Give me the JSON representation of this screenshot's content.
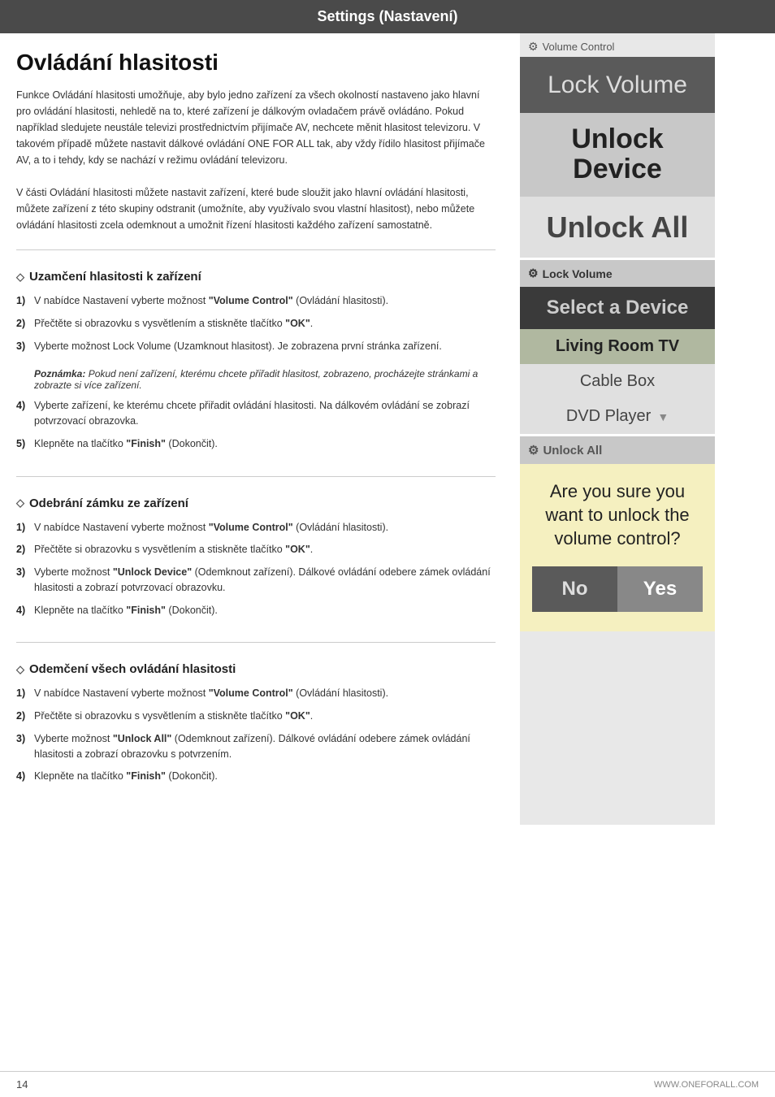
{
  "header": {
    "title": "Settings (Nastavení)"
  },
  "main": {
    "title": "Ovládání hlasitosti",
    "intro": [
      "Funkce Ovládání hlasitosti umožňuje, aby bylo jedno zařízení za všech okolností nastaveno jako hlavní pro ovládání hlasitosti, nehledě na to, které zařízení je dálkovým ovladačem právě ovládáno.  Pokud například sledujete neustále televizi prostřednictvím přijímače AV, nechcete měnit hlasitost televizoru. V takovém případě můžete nastavit dálkové ovládání ONE FOR ALL tak, aby vždy řídilo hlasitost přijímače AV, a to i tehdy, kdy se nachází v režimu ovládání televizoru.",
      "V části Ovládání hlasitosti můžete nastavit zařízení, které bude sloužit jako hlavní ovládání hlasitosti, můžete zařízení z této skupiny odstranit (umožníte, aby využívalo svou vlastní hlasitost), nebo můžete ovládání hlasitosti zcela odemknout a umožnit řízení hlasitosti každého zařízení samostatně."
    ],
    "sections": [
      {
        "heading": "Uzamčení hlasitosti k zařízení",
        "steps": [
          {
            "num": "1)",
            "text": "V nabídce Nastavení vyberte možnost ",
            "bold": "\"Volume Control\"",
            "text2": " (Ovládání hlasitosti)."
          },
          {
            "num": "2)",
            "text": "Přečtěte si obrazovku s vysvětlením a stiskněte tlačítko ",
            "bold": "\"OK\"",
            "text2": "."
          },
          {
            "num": "3)",
            "text": "Vyberte možnost Lock Volume (Uzamknout hlasitost). Je zobrazena první stránka zařízení."
          },
          {
            "note": "Poznámka: Pokud není zařízení, kterému chcete přiřadit hlasitost, zobrazeno, procházejte stránkami a zobrazte si více zařízení."
          },
          {
            "num": "4)",
            "text": "Vyberte zařízení, ke kterému chcete přiřadit ovládání hlasitosti. Na dálkovém ovládání se zobrazí potvrzovací obrazovka."
          },
          {
            "num": "5)",
            "text": "Klepněte na tlačítko ",
            "bold": "\"Finish\"",
            "text2": " (Dokončit)."
          }
        ]
      },
      {
        "heading": "Odebrání zámku ze zařízení",
        "steps": [
          {
            "num": "1)",
            "text": "V nabídce Nastavení vyberte možnost ",
            "bold": "\"Volume Control\"",
            "text2": " (Ovládání hlasitosti)."
          },
          {
            "num": "2)",
            "text": "Přečtěte si obrazovku s vysvětlením a stiskněte tlačítko ",
            "bold": "\"OK\"",
            "text2": "."
          },
          {
            "num": "3)",
            "text": "Vyberte možnost ",
            "bold": "\"Unlock Device\"",
            "text2": " (Odemknout zařízení). Dálkové ovládání odebere zámek ovládání hlasitosti a zobrazí potvrzovací obrazovku."
          },
          {
            "num": "4)",
            "text": "Klepněte na tlačítko ",
            "bold": "\"Finish\"",
            "text2": " (Dokončit)."
          }
        ]
      },
      {
        "heading": "Odemčení všech ovládání hlasitosti",
        "steps": [
          {
            "num": "1)",
            "text": "V nabídce Nastavení vyberte možnost ",
            "bold": "\"Volume Control\"",
            "text2": " (Ovládání hlasitosti)."
          },
          {
            "num": "2)",
            "text": "Přečtěte si obrazovku s vysvětlením a stiskněte tlačítko ",
            "bold": "\"OK\"",
            "text2": "."
          },
          {
            "num": "3)",
            "text": "Vyberte možnost ",
            "bold": "\"Unlock All\"",
            "text2": " (Odemknout zařízení). Dálkové ovládání odebere zámek ovládání hlasitosti a zobrazí obrazovku s potvrzením."
          },
          {
            "num": "4)",
            "text": "Klepněte na tlačítko ",
            "bold": "\"Finish\"",
            "text2": " (Dokončit)."
          }
        ]
      }
    ]
  },
  "sidebar": {
    "panel1": {
      "label": "Volume Control",
      "items": [
        {
          "text": "Lock Volume",
          "type": "dark"
        },
        {
          "text": "Unlock Device",
          "type": "medium"
        },
        {
          "text": "Unlock All",
          "type": "light"
        }
      ]
    },
    "panel2": {
      "label": "Lock Volume",
      "items": [
        {
          "text": "Select a Device",
          "type": "dark"
        },
        {
          "text": "Living Room TV",
          "type": "green"
        },
        {
          "text": "Cable Box",
          "type": "light"
        },
        {
          "text": "DVD Player",
          "type": "light"
        }
      ]
    },
    "panel3": {
      "label": "Unlock All",
      "question": "Are you sure you want to unlock the volume control?",
      "btn_no": "No",
      "btn_yes": "Yes"
    }
  },
  "footer": {
    "page_num": "14",
    "url": "WWW.ONEFORALL.COM"
  }
}
